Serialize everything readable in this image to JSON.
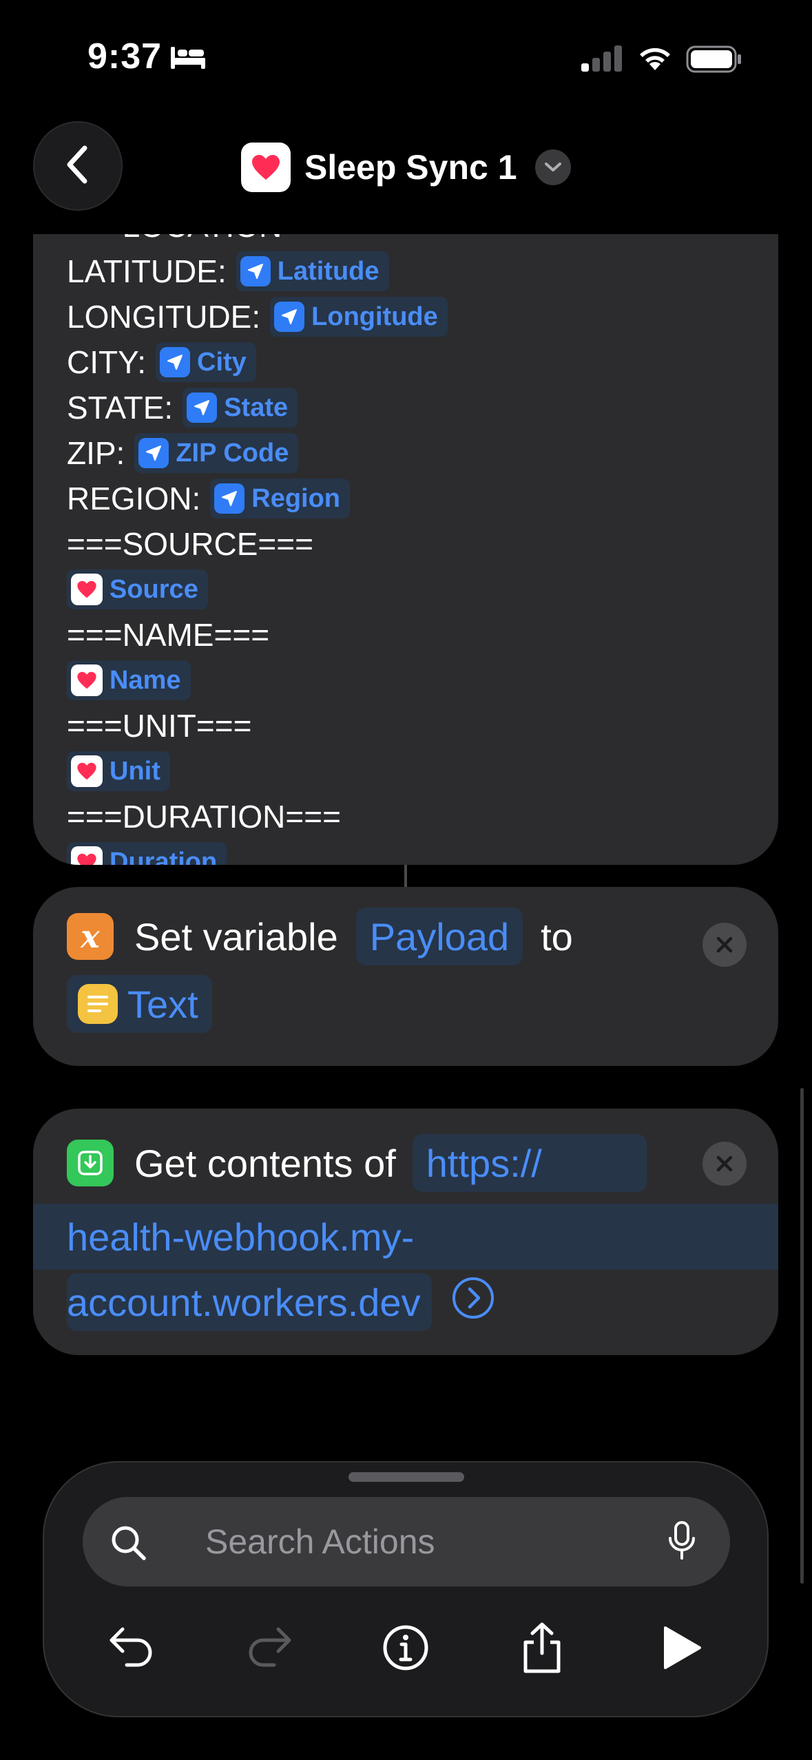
{
  "status_bar": {
    "time": "9:37"
  },
  "nav": {
    "title": "Sleep Sync 1"
  },
  "text_block": {
    "lines": [
      {
        "label": "===LOCATION===",
        "chip": null,
        "chip_icon": null
      },
      {
        "label": "LATITUDE:",
        "chip": "Latitude",
        "chip_icon": "location"
      },
      {
        "label": "LONGITUDE:",
        "chip": "Longitude",
        "chip_icon": "location"
      },
      {
        "label": "CITY:",
        "chip": "City",
        "chip_icon": "location"
      },
      {
        "label": "STATE:",
        "chip": "State",
        "chip_icon": "location"
      },
      {
        "label": "ZIP:",
        "chip": "ZIP Code",
        "chip_icon": "location"
      },
      {
        "label": "REGION:",
        "chip": "Region",
        "chip_icon": "location"
      },
      {
        "label": "===SOURCE===",
        "chip": null,
        "chip_icon": null
      },
      {
        "label": "",
        "chip": "Source",
        "chip_icon": "health"
      },
      {
        "label": "===NAME===",
        "chip": null,
        "chip_icon": null
      },
      {
        "label": "",
        "chip": "Name",
        "chip_icon": "health"
      },
      {
        "label": "===UNIT===",
        "chip": null,
        "chip_icon": null
      },
      {
        "label": "",
        "chip": "Unit",
        "chip_icon": "health"
      },
      {
        "label": "===DURATION===",
        "chip": null,
        "chip_icon": null
      },
      {
        "label": "",
        "chip": "Duration",
        "chip_icon": "health"
      }
    ]
  },
  "set_variable": {
    "prefix": "Set variable",
    "variable": "Payload",
    "connector": "to",
    "value": "Text"
  },
  "get_contents": {
    "prefix": "Get contents of",
    "url_part1": "https://",
    "url_part2": "health-webhook.my-",
    "url_part3": "account.workers.dev"
  },
  "search": {
    "placeholder": "Search Actions"
  },
  "colors": {
    "background": "#000000",
    "card": "#2c2c2e",
    "accent_blue": "#4a8df8",
    "chip_bg": "#263548",
    "variable_orange": "#ee8a33",
    "text_yellow": "#f4c341",
    "web_green": "#34c759",
    "health_red": "#ff2d55"
  },
  "icons": [
    "bed-icon",
    "signal-icon",
    "wifi-icon",
    "battery-icon",
    "back-chevron-icon",
    "health-heart-icon",
    "chevron-down-icon",
    "location-arrow-icon",
    "variable-x-icon",
    "text-lines-icon",
    "download-icon",
    "close-x-icon",
    "chevron-right-circle-icon",
    "search-icon",
    "microphone-icon",
    "undo-icon",
    "redo-icon",
    "info-icon",
    "share-icon",
    "play-icon"
  ]
}
